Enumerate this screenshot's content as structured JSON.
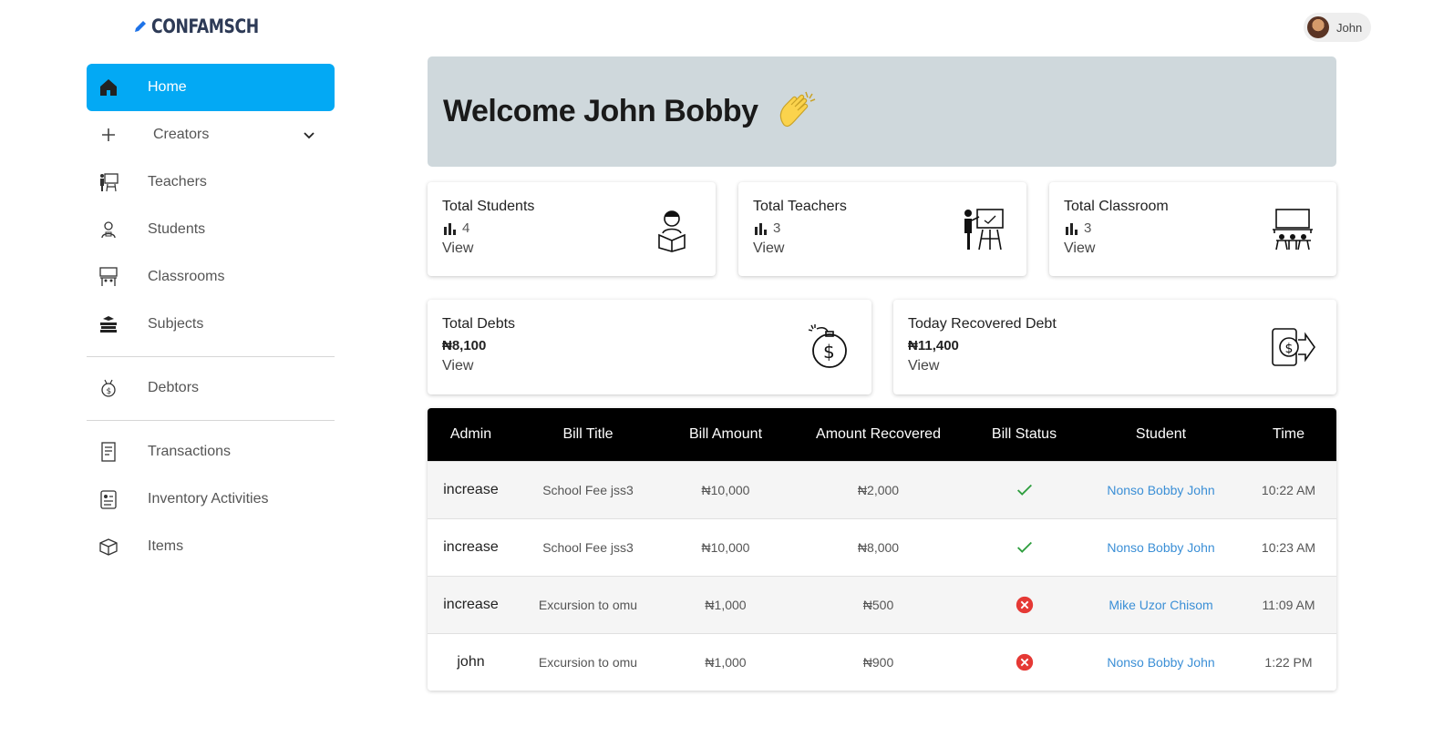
{
  "brand": {
    "name": "CONFAMSCH",
    "icon": "pencil-icon"
  },
  "user": {
    "name": "John",
    "avatar": "user-avatar"
  },
  "sidebar": {
    "items": [
      {
        "label": "Home",
        "icon": "home-icon",
        "active": true
      },
      {
        "label": "Creators",
        "icon": "plus-icon",
        "expandable": true
      },
      {
        "label": "Teachers",
        "icon": "teacher-icon"
      },
      {
        "label": "Students",
        "icon": "student-icon"
      },
      {
        "label": "Classrooms",
        "icon": "classroom-icon"
      },
      {
        "label": "Subjects",
        "icon": "books-icon"
      },
      {
        "label": "Debtors",
        "icon": "money-bag-icon"
      },
      {
        "label": "Transactions",
        "icon": "receipt-icon"
      },
      {
        "label": "Inventory Activities",
        "icon": "clipboard-icon"
      },
      {
        "label": "Items",
        "icon": "box-icon"
      }
    ]
  },
  "welcome": {
    "title": "Welcome John Bobby",
    "icon": "clapping-hands-icon"
  },
  "stats": {
    "students": {
      "title": "Total Students",
      "value": "4",
      "link": "View",
      "icon": "student-reading-icon"
    },
    "teachers": {
      "title": "Total Teachers",
      "value": "3",
      "link": "View",
      "icon": "teacher-board-icon"
    },
    "classroom": {
      "title": "Total Classroom",
      "value": "3",
      "link": "View",
      "icon": "classroom-desks-icon"
    },
    "debts": {
      "title": "Total Debts",
      "value": "₦8,100",
      "link": "View",
      "icon": "money-bomb-icon"
    },
    "recovered": {
      "title": "Today Recovered Debt",
      "value": "₦11,400",
      "link": "View",
      "icon": "payment-transfer-icon"
    }
  },
  "table": {
    "headers": [
      "Admin",
      "Bill Title",
      "Bill Amount",
      "Amount Recovered",
      "Bill Status",
      "Student",
      "Time"
    ],
    "rows": [
      {
        "admin": "increase",
        "bill_title": "School Fee jss3",
        "bill_amount": "₦10,000",
        "recovered": "₦2,000",
        "status": "paid",
        "student": "Nonso Bobby John",
        "time": "10:22 AM"
      },
      {
        "admin": "increase",
        "bill_title": "School Fee jss3",
        "bill_amount": "₦10,000",
        "recovered": "₦8,000",
        "status": "paid",
        "student": "Nonso Bobby John",
        "time": "10:23 AM"
      },
      {
        "admin": "increase",
        "bill_title": "Excursion to omu",
        "bill_amount": "₦1,000",
        "recovered": "₦500",
        "status": "unpaid",
        "student": "Mike Uzor Chisom",
        "time": "11:09 AM"
      },
      {
        "admin": "john",
        "bill_title": "Excursion to omu",
        "bill_amount": "₦1,000",
        "recovered": "₦900",
        "status": "unpaid",
        "student": "Nonso Bobby John",
        "time": "1:22 PM"
      }
    ]
  },
  "colors": {
    "accent": "#03a9f4",
    "banner": "#cfd8dc",
    "success": "#2e9e3e",
    "error": "#e53935",
    "link": "#3b8fd6"
  }
}
